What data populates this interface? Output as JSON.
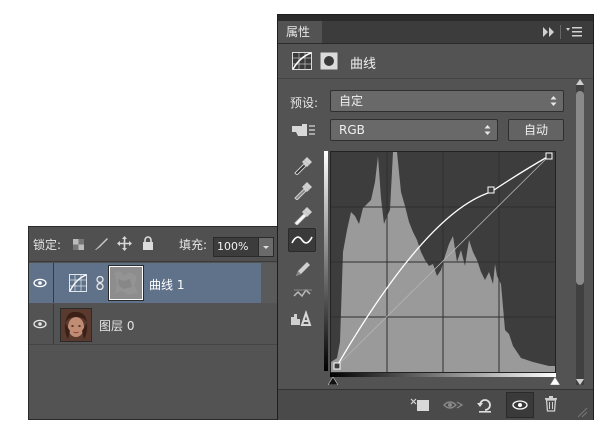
{
  "layers_panel": {
    "lock_label": "锁定:",
    "fill_label": "填充:",
    "fill_value": "100%",
    "layers": [
      {
        "name": "曲线 1",
        "selected": true,
        "visible": true
      },
      {
        "name": "图层 0",
        "selected": false,
        "visible": true
      }
    ]
  },
  "properties_panel": {
    "tab_label": "属性",
    "title": "曲线",
    "preset_label": "预设:",
    "preset_value": "自定",
    "channel_value": "RGB",
    "auto_button": "自动",
    "curve_points": [
      {
        "input": 0,
        "output": 0
      },
      {
        "input": 183,
        "output": 187
      },
      {
        "input": 255,
        "output": 255
      }
    ]
  },
  "colors": {
    "panel_bg": "#535353",
    "selected_row": "#60728a",
    "histogram": "#9a9a9a",
    "curve": "#ffffff"
  }
}
